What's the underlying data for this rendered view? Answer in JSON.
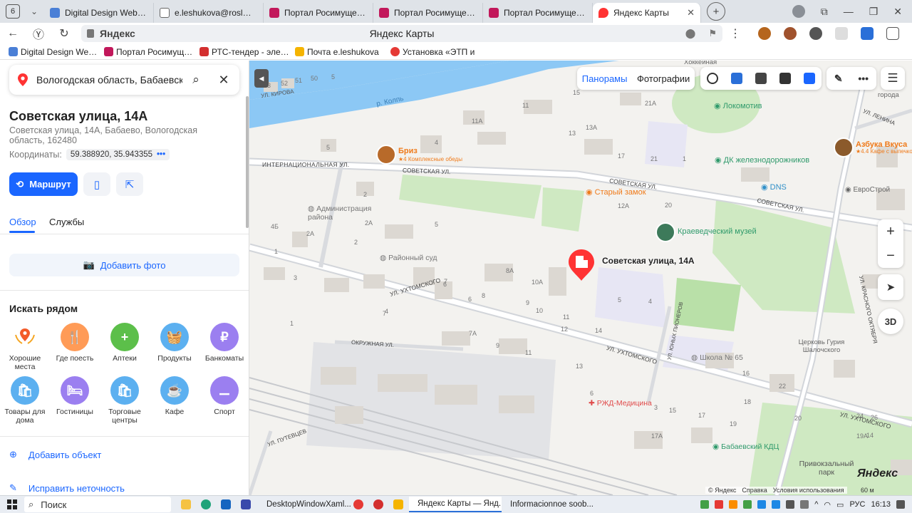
{
  "browser": {
    "tab_count": "6",
    "tabs": [
      {
        "label": "Digital Design Web Client",
        "color": "#4a7fd6"
      },
      {
        "label": "e.leshukova@roslm.gov",
        "color": "#666666"
      },
      {
        "label": "Портал Росимущества",
        "color": "#c2185b"
      },
      {
        "label": "Портал Росимущества",
        "color": "#c2185b"
      },
      {
        "label": "Портал Росимущества",
        "color": "#c2185b"
      },
      {
        "label": "Яндекс Карты",
        "color": "#f33",
        "active": true
      }
    ],
    "url_host": "Яндекс",
    "page_title": "Яндекс Карты",
    "bookmarks": [
      {
        "label": "Digital Design Web Client",
        "color": "#4a7fd6"
      },
      {
        "label": "Портал Росимущества",
        "color": "#c2185b"
      },
      {
        "label": "РТС-тендер - электр",
        "color": "#d32f2f"
      },
      {
        "label": "Почта e.leshukova",
        "color": "#f5b400"
      },
      {
        "label": "Установка «ЭТП и",
        "color": "#e53935"
      }
    ]
  },
  "panel": {
    "search_value": "Вологодская область, Бабаевский ра",
    "title": "Советская улица, 14А",
    "address": "Советская улица, 14А, Бабаево, Вологодская область, 162480",
    "coords_label": "Координаты:",
    "coords_value": "59.388920, 35.943355",
    "route_label": "Маршрут",
    "tabs": [
      "Обзор",
      "Службы"
    ],
    "add_photo": "Добавить фото",
    "nearby_title": "Искать рядом",
    "categories": [
      {
        "label": "Хорошие места",
        "color": "#ffffff",
        "icon": "award-icon"
      },
      {
        "label": "Где поесть",
        "color": "#ff9b57",
        "icon": "fork-knife-icon"
      },
      {
        "label": "Аптеки",
        "color": "#5cbf4a",
        "icon": "plus-icon"
      },
      {
        "label": "Продукты",
        "color": "#5cb0f0",
        "icon": "basket-icon"
      },
      {
        "label": "Банкоматы",
        "color": "#9b7ff0",
        "icon": "ruble-icon"
      },
      {
        "label": "Товары для дома",
        "color": "#5cb0f0",
        "icon": "bag-icon"
      },
      {
        "label": "Гостиницы",
        "color": "#9b7ff0",
        "icon": "bed-icon"
      },
      {
        "label": "Торговые центры",
        "color": "#5cb0f0",
        "icon": "bag-icon"
      },
      {
        "label": "Кафе",
        "color": "#5cb0f0",
        "icon": "cup-icon"
      },
      {
        "label": "Спорт",
        "color": "#9b7ff0",
        "icon": "dumbbell-icon"
      }
    ],
    "add_object": "Добавить объект",
    "fix_error": "Исправить неточность"
  },
  "map": {
    "top_tabs": [
      "Панорамы",
      "Фотографии"
    ],
    "marker_label": "Советская улица, 14А",
    "streets": [
      "СОВЕТСКАЯ УЛ.",
      "ИНТЕРНАЦИОНАЛЬНАЯ УЛ.",
      "УЛ. УХТОМСКОГО",
      "ОКРУЖНАЯ УЛ.",
      "УЛ. КИРОВА",
      "УЛ. ПУТЕВЦЕВ",
      "УЛ. КРАСНОГО ОКТЯБРЯ",
      "УЛ. ЮНЫХ ПИОНЕРОВ",
      "УЛ. ЛЕНИНА"
    ],
    "river": "р. Колпь",
    "pois": [
      {
        "label": "Бриз",
        "sub": "★4 Комплексные обеды",
        "color": "#ef7a1a"
      },
      {
        "label": "Локомотив",
        "color": "#2f9a6b"
      },
      {
        "label": "ДК железнодорожников",
        "color": "#2f9a6b"
      },
      {
        "label": "DNS",
        "color": "#2f8fc8"
      },
      {
        "label": "Старый замок",
        "color": "#ef7a1a"
      },
      {
        "label": "ЕвроСтрой",
        "color": "#666666"
      },
      {
        "label": "Краеведческий музей",
        "color": "#2f9a6b"
      },
      {
        "label": "Администрация района",
        "color": "#777777"
      },
      {
        "label": "Районный суд",
        "color": "#777777"
      },
      {
        "label": "Школа № 65",
        "color": "#777777"
      },
      {
        "label": "РЖД-Медицина",
        "color": "#e04a4a"
      },
      {
        "label": "Бабаевский КДЦ",
        "color": "#2f9a6b"
      },
      {
        "label": "Привокзальный парк",
        "color": "#555555"
      },
      {
        "label": "Церковь Гурия Шалочского",
        "color": "#666666"
      },
      {
        "label": "Азбука Вкуса",
        "sub": "★4.4 Кафе с выпечкой",
        "color": "#ef7a1a"
      },
      {
        "label": "Хоккейная",
        "color": "#666666"
      },
      {
        "label": "города",
        "color": "#666666"
      }
    ],
    "house_numbers": [
      "53",
      "52",
      "51",
      "50",
      "5",
      "11",
      "15",
      "21А",
      "11А",
      "13А",
      "13",
      "17",
      "21",
      "1",
      "5",
      "4",
      "5",
      "7",
      "9",
      "11",
      "12А",
      "20",
      "2",
      "4Б",
      "2А",
      "2А",
      "2",
      "1",
      "8А",
      "10А",
      "5",
      "6",
      "6",
      "8",
      "10",
      "12",
      "14",
      "4",
      "3",
      "7",
      "7А",
      "9",
      "11",
      "13",
      "6",
      "1",
      "4",
      "3",
      "17",
      "16",
      "18",
      "22",
      "20",
      "24",
      "26",
      "17А",
      "19",
      "19А",
      "14",
      "15"
    ],
    "controls": {
      "three_d": "3D"
    },
    "footer": [
      "© Яндекс",
      "Справка",
      "Условия использования"
    ],
    "scale": "60 м",
    "logo": "Яндекс"
  },
  "taskbar": {
    "search_placeholder": "Поиск",
    "apps": [
      {
        "label": "DesktopWindowXaml...",
        "color": "#2a6fd8"
      },
      {
        "label": "Яндекс Карты — Янд...",
        "color": "#e53935",
        "active": true
      },
      {
        "label": "Informacionnoe soob...",
        "color": "#2a6fd8"
      }
    ],
    "lang": "РУС",
    "time": "16:13"
  }
}
